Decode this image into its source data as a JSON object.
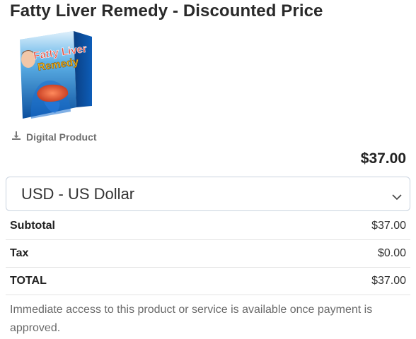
{
  "product": {
    "title": "Fatty Liver Remedy - Discounted Price",
    "box_text_line1": "Fatty Liver",
    "box_text_line2": "Remedy",
    "type_label": "Digital Product",
    "price": "$37.00"
  },
  "currency": {
    "selected": "USD - US Dollar"
  },
  "summary": {
    "rows": [
      {
        "label": "Subtotal",
        "value": "$37.00"
      },
      {
        "label": "Tax",
        "value": "$0.00"
      },
      {
        "label": "TOTAL",
        "value": "$37.00"
      }
    ]
  },
  "note": "Immediate access to this product or service is available once payment is approved.",
  "icons": {
    "download": "download-icon",
    "dropdown": "chevron-down-icon"
  }
}
